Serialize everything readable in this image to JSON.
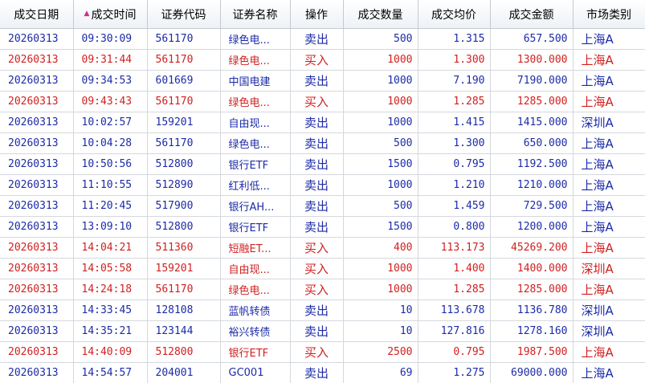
{
  "columns": [
    {
      "key": "date",
      "label": "成交日期"
    },
    {
      "key": "time",
      "label": "成交时间",
      "sorted": true
    },
    {
      "key": "code",
      "label": "证券代码"
    },
    {
      "key": "name",
      "label": "证券名称"
    },
    {
      "key": "op",
      "label": "操作"
    },
    {
      "key": "qty",
      "label": "成交数量"
    },
    {
      "key": "price",
      "label": "成交均价"
    },
    {
      "key": "amount",
      "label": "成交金额"
    },
    {
      "key": "market",
      "label": "市场类别"
    }
  ],
  "colors": {
    "sell": "#1c2ba8",
    "buy": "#d11f1f",
    "sort_indicator": "#d12a8c"
  },
  "icons": {
    "sort": "sort-ascending-icon"
  },
  "rows": [
    {
      "side": "sell",
      "date": "20260313",
      "time": "09:30:09",
      "code": "561170",
      "name": "绿色电...",
      "op": "卖出",
      "qty": "500",
      "price": "1.315",
      "amount": "657.500",
      "market": "上海A"
    },
    {
      "side": "buy",
      "date": "20260313",
      "time": "09:31:44",
      "code": "561170",
      "name": "绿色电...",
      "op": "买入",
      "qty": "1000",
      "price": "1.300",
      "amount": "1300.000",
      "market": "上海A"
    },
    {
      "side": "sell",
      "date": "20260313",
      "time": "09:34:53",
      "code": "601669",
      "name": "中国电建",
      "op": "卖出",
      "qty": "1000",
      "price": "7.190",
      "amount": "7190.000",
      "market": "上海A"
    },
    {
      "side": "buy",
      "date": "20260313",
      "time": "09:43:43",
      "code": "561170",
      "name": "绿色电...",
      "op": "买入",
      "qty": "1000",
      "price": "1.285",
      "amount": "1285.000",
      "market": "上海A"
    },
    {
      "side": "sell",
      "date": "20260313",
      "time": "10:02:57",
      "code": "159201",
      "name": "自由现...",
      "op": "卖出",
      "qty": "1000",
      "price": "1.415",
      "amount": "1415.000",
      "market": "深圳A"
    },
    {
      "side": "sell",
      "date": "20260313",
      "time": "10:04:28",
      "code": "561170",
      "name": "绿色电...",
      "op": "卖出",
      "qty": "500",
      "price": "1.300",
      "amount": "650.000",
      "market": "上海A"
    },
    {
      "side": "sell",
      "date": "20260313",
      "time": "10:50:56",
      "code": "512800",
      "name": "银行ETF",
      "op": "卖出",
      "qty": "1500",
      "price": "0.795",
      "amount": "1192.500",
      "market": "上海A"
    },
    {
      "side": "sell",
      "date": "20260313",
      "time": "11:10:55",
      "code": "512890",
      "name": "红利低...",
      "op": "卖出",
      "qty": "1000",
      "price": "1.210",
      "amount": "1210.000",
      "market": "上海A"
    },
    {
      "side": "sell",
      "date": "20260313",
      "time": "11:20:45",
      "code": "517900",
      "name": "银行AH...",
      "op": "卖出",
      "qty": "500",
      "price": "1.459",
      "amount": "729.500",
      "market": "上海A"
    },
    {
      "side": "sell",
      "date": "20260313",
      "time": "13:09:10",
      "code": "512800",
      "name": "银行ETF",
      "op": "卖出",
      "qty": "1500",
      "price": "0.800",
      "amount": "1200.000",
      "market": "上海A"
    },
    {
      "side": "buy",
      "date": "20260313",
      "time": "14:04:21",
      "code": "511360",
      "name": "短融ET...",
      "op": "买入",
      "qty": "400",
      "price": "113.173",
      "amount": "45269.200",
      "market": "上海A"
    },
    {
      "side": "buy",
      "date": "20260313",
      "time": "14:05:58",
      "code": "159201",
      "name": "自由现...",
      "op": "买入",
      "qty": "1000",
      "price": "1.400",
      "amount": "1400.000",
      "market": "深圳A"
    },
    {
      "side": "buy",
      "date": "20260313",
      "time": "14:24:18",
      "code": "561170",
      "name": "绿色电...",
      "op": "买入",
      "qty": "1000",
      "price": "1.285",
      "amount": "1285.000",
      "market": "上海A"
    },
    {
      "side": "sell",
      "date": "20260313",
      "time": "14:33:45",
      "code": "128108",
      "name": "蓝帆转债",
      "op": "卖出",
      "qty": "10",
      "price": "113.678",
      "amount": "1136.780",
      "market": "深圳A"
    },
    {
      "side": "sell",
      "date": "20260313",
      "time": "14:35:21",
      "code": "123144",
      "name": "裕兴转债",
      "op": "卖出",
      "qty": "10",
      "price": "127.816",
      "amount": "1278.160",
      "market": "深圳A"
    },
    {
      "side": "buy",
      "date": "20260313",
      "time": "14:40:09",
      "code": "512800",
      "name": "银行ETF",
      "op": "买入",
      "qty": "2500",
      "price": "0.795",
      "amount": "1987.500",
      "market": "上海A"
    },
    {
      "side": "sell",
      "date": "20260313",
      "time": "14:54:57",
      "code": "204001",
      "name": "GC001",
      "op": "卖出",
      "qty": "69",
      "price": "1.275",
      "amount": "69000.000",
      "market": "上海A"
    }
  ]
}
